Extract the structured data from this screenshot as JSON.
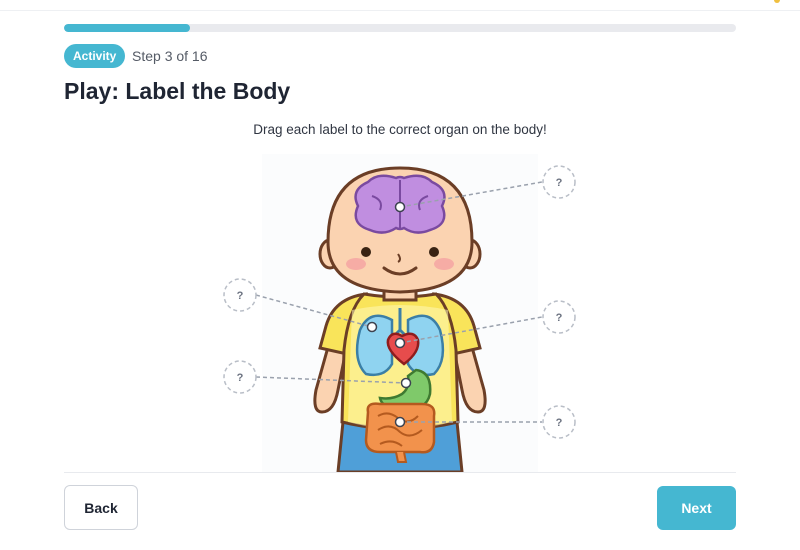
{
  "progress": {
    "fraction": 0.1875
  },
  "header": {
    "badge": "Activity",
    "step": "Step 3 of 16",
    "title": "Play: Label the Body"
  },
  "activity": {
    "instructions": "Drag each label to the correct organ on the body!",
    "slots": [
      {
        "id": "brain",
        "label": "?"
      },
      {
        "id": "lungs",
        "label": "?"
      },
      {
        "id": "heart",
        "label": "?"
      },
      {
        "id": "stomach",
        "label": "?"
      },
      {
        "id": "intestines",
        "label": "?"
      }
    ]
  },
  "nav": {
    "back": "Back",
    "next": "Next"
  },
  "colors": {
    "accent": "#45b7d1",
    "brain": "#c08ee0",
    "heart": "#e74c4c",
    "stomach": "#7fc96a",
    "intestines": "#f2924c",
    "lungs": "#8fd3f0",
    "shirt": "#f9e45a",
    "pants": "#4f9fd8",
    "skin": "#fbd3b1"
  }
}
